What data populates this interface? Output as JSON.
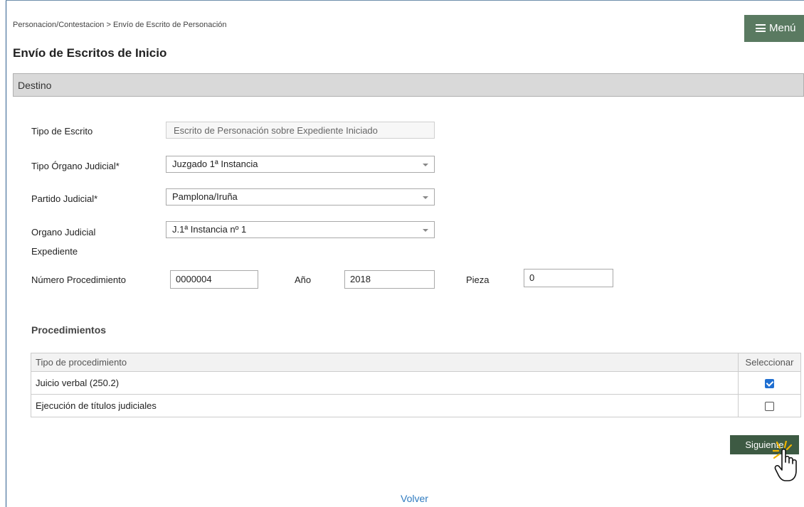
{
  "breadcrumb": "Personacion/Contestacion > Envío de Escrito de Personación",
  "menu": {
    "label": "Menú",
    "icon": "hamburger-icon"
  },
  "page_title": "Envío de Escritos de Inicio",
  "section": {
    "title": "Destino"
  },
  "form": {
    "tipo_escrito": {
      "label": "Tipo de Escrito",
      "value": "Escrito de Personación sobre Expediente Iniciado"
    },
    "tipo_organo": {
      "label": "Tipo Órgano Judicial*",
      "value": "Juzgado 1ª Instancia"
    },
    "partido": {
      "label": "Partido Judicial*",
      "value": "Pamplona/Iruña"
    },
    "organo": {
      "label": "Organo Judicial",
      "value": "J.1ª Instancia nº 1"
    },
    "expediente_label": "Expediente",
    "numero": {
      "label": "Número Procedimiento",
      "value": "0000004"
    },
    "anio": {
      "label": "Año",
      "value": "2018"
    },
    "pieza": {
      "label": "Pieza",
      "value": "0"
    }
  },
  "procedimientos": {
    "heading": "Procedimientos",
    "columns": [
      "Tipo de procedimiento",
      "Seleccionar"
    ],
    "rows": [
      {
        "tipo": "Juicio verbal (250.2)",
        "selected": true
      },
      {
        "tipo": "Ejecución de títulos judiciales",
        "selected": false
      }
    ]
  },
  "buttons": {
    "next": "Siguiente",
    "back": "Volver"
  },
  "colors": {
    "menu_bg": "#5a7a61",
    "button_bg": "#3d5a43",
    "link": "#2f7bc0",
    "checkbox": "#1f6fd1"
  }
}
